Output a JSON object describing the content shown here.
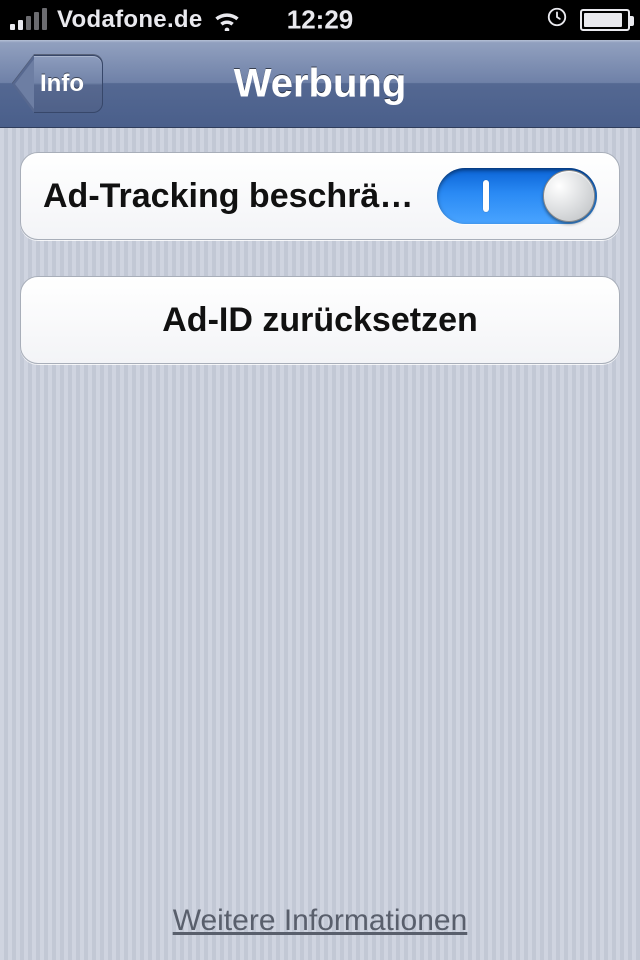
{
  "status_bar": {
    "carrier": "Vodafone.de",
    "time": "12:29",
    "signal_bars_active": 2,
    "signal_bars_total": 5
  },
  "nav": {
    "back_label": "Info",
    "title": "Werbung"
  },
  "settings": {
    "limit_ad_tracking": {
      "label": "Ad-Tracking beschränken",
      "value_on": true
    },
    "reset_ad_id": {
      "label": "Ad-ID zurücksetzen"
    }
  },
  "footer": {
    "more_info": "Weitere Informationen"
  }
}
